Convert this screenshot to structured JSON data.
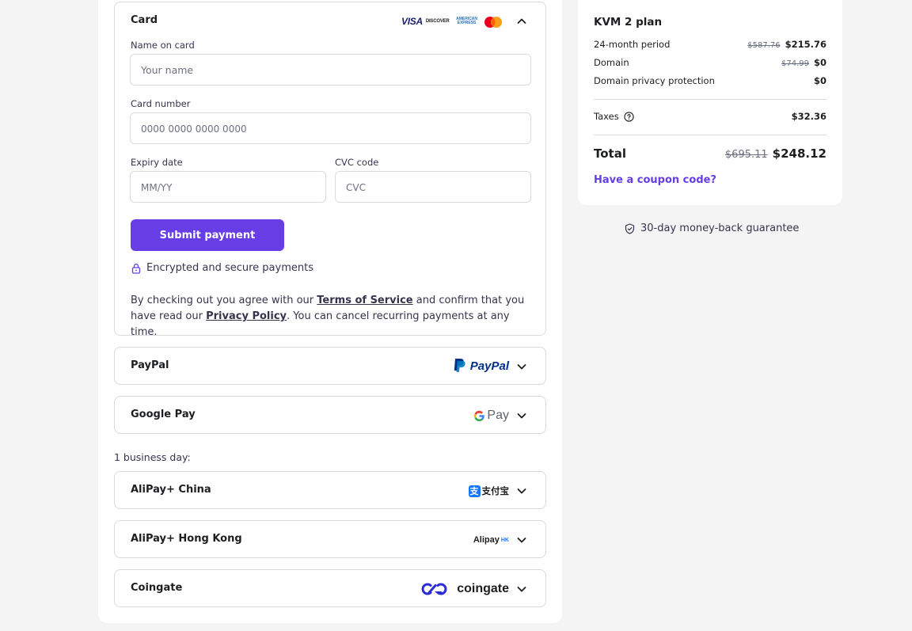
{
  "card": {
    "title": "Card",
    "brands": [
      "VISA",
      "DISCOVER",
      "AMERICAN EXPRESS",
      "mastercard"
    ],
    "name_label": "Name on card",
    "name_placeholder": "Your name",
    "number_label": "Card number",
    "number_placeholder": "0000 0000 0000 0000",
    "expiry_label": "Expiry date",
    "expiry_placeholder": "MM/YY",
    "cvc_label": "CVC code",
    "cvc_placeholder": "CVC",
    "submit_label": "Submit payment",
    "secure_text": "Encrypted and secure payments",
    "terms_before": "By checking out you agree with our ",
    "terms_link": "Terms of Service",
    "terms_middle": " and confirm that you have read our ",
    "privacy_link": "Privacy Policy",
    "terms_after": ". You can cancel recurring payments at any time."
  },
  "methods": {
    "paypal": {
      "label": "PayPal",
      "logo": "PayPal"
    },
    "googlepay": {
      "label": "Google Pay",
      "logo": "Pay"
    },
    "business_day_label": "1 business day:",
    "alipay_china": {
      "label": "AliPay+ China",
      "logo": "支付宝"
    },
    "alipay_hk": {
      "label": "AliPay+ Hong Kong",
      "logo": "Alipay",
      "logo_suffix": "HK"
    },
    "coingate": {
      "label": "Coingate",
      "logo": "coingate"
    }
  },
  "summary": {
    "plan": "KVM 2 plan",
    "rows": [
      {
        "label": "24-month period",
        "old": "$587.76",
        "price": "$215.76"
      },
      {
        "label": "Domain",
        "old": "$74.99",
        "price": "$0"
      },
      {
        "label": "Domain privacy protection",
        "old": "",
        "price": "$0"
      }
    ],
    "taxes_label": "Taxes",
    "taxes_value": "$32.36",
    "total_label": "Total",
    "total_old": "$695.11",
    "total_price": "$248.12",
    "coupon_label": "Have a coupon code?",
    "guarantee": "30-day money-back guarantee"
  },
  "colors": {
    "accent": "#673de6",
    "text": "#1d1e20",
    "border": "#d8dae0",
    "background": "#f4f4f4"
  },
  "icons": [
    "chevron-up-icon",
    "chevron-down-icon",
    "lock-icon",
    "help-circle-icon",
    "shield-check-icon"
  ]
}
